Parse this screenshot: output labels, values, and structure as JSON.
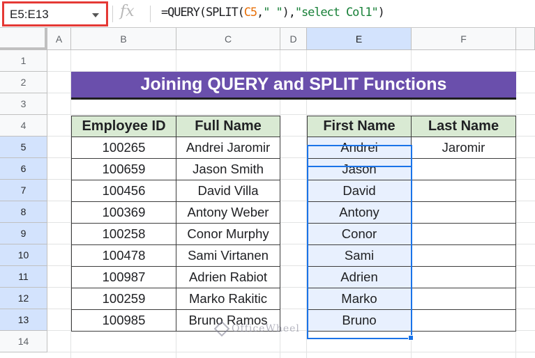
{
  "formula_bar": {
    "name_box": "E5:E13",
    "fx_label": "fx",
    "formula_prefix": "=QUERY(SPLIT(",
    "formula_ref": "C5",
    "formula_comma1": ",",
    "formula_str1": "\" \"",
    "formula_mid": "),",
    "formula_str2": "\"select Col1\"",
    "formula_suffix": ")"
  },
  "columns": [
    "A",
    "B",
    "C",
    "D",
    "E",
    "F"
  ],
  "rows": [
    "1",
    "2",
    "3",
    "4",
    "5",
    "6",
    "7",
    "8",
    "9",
    "10",
    "11",
    "12",
    "13",
    "14"
  ],
  "title": "Joining QUERY and SPLIT Functions",
  "left_table": {
    "headers": [
      "Employee ID",
      "Full Name"
    ],
    "rows": [
      [
        "100265",
        "Andrei Jaromir"
      ],
      [
        "100659",
        "Jason Smith"
      ],
      [
        "100456",
        "David Villa"
      ],
      [
        "100369",
        "Antony Weber"
      ],
      [
        "100258",
        "Conor Murphy"
      ],
      [
        "100478",
        "Sami Virtanen"
      ],
      [
        "100987",
        "Adrien Rabiot"
      ],
      [
        "100259",
        "Marko Rakitic"
      ],
      [
        "100985",
        "Bruno Ramos"
      ]
    ]
  },
  "right_table": {
    "headers": [
      "First Name",
      "Last Name"
    ],
    "rows": [
      [
        "Andrei",
        "Jaromir"
      ],
      [
        "Jason",
        ""
      ],
      [
        "David",
        ""
      ],
      [
        "Antony",
        ""
      ],
      [
        "Conor",
        ""
      ],
      [
        "Sami",
        ""
      ],
      [
        "Adrien",
        ""
      ],
      [
        "Marko",
        ""
      ],
      [
        "Bruno",
        ""
      ]
    ]
  },
  "watermark": "OfficeWheel",
  "colors": {
    "title_bg": "#6a4fac",
    "header_bg": "#d9ead3",
    "selection": "#1a73e8",
    "name_box_border": "#e53935"
  }
}
